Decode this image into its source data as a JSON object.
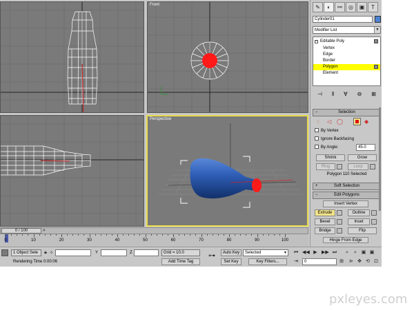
{
  "viewports": {
    "top": "",
    "front": "Front",
    "left": "",
    "perspective": "Perspective"
  },
  "command_panel": {
    "tabs": [
      "create-icon",
      "modify-icon",
      "hierarchy-icon",
      "motion-icon",
      "display-icon",
      "utilities-icon"
    ],
    "object_name": "Cylinder01",
    "object_color": "#4a82d4",
    "modifier_list": "Modifier List",
    "stack": {
      "root": "Editable Poly",
      "items": [
        "Vertex",
        "Edge",
        "Border",
        "Polygon",
        "Element"
      ],
      "selected": "Polygon"
    },
    "selection": {
      "title": "Selection",
      "by_vertex": "By Vertex",
      "ignore_backfacing": "Ignore Backfacing",
      "by_angle": "By Angle:",
      "angle_value": "45.0",
      "shrink": "Shrink",
      "grow": "Grow",
      "ring": "Ring",
      "loop": "Loop",
      "status": "Polygon 110 Selected"
    },
    "soft_selection": {
      "title": "Soft Selection"
    },
    "edit_polygons": {
      "title": "Edit Polygons",
      "insert_vertex": "Insert Vertex",
      "extrude": "Extrude",
      "outline": "Outline",
      "bevel": "Bevel",
      "inset": "Inset",
      "bridge": "Bridge",
      "flip": "Flip",
      "hinge": "Hinge From Edge"
    }
  },
  "timeline": {
    "frame": "0 / 100",
    "ticks": [
      "0",
      "10",
      "20",
      "30",
      "40",
      "50",
      "60",
      "70",
      "80",
      "90",
      "100"
    ]
  },
  "status": {
    "selection": "1 Object Sele",
    "x_label": "X",
    "y_label": "Y",
    "z_label": "Z",
    "grid": "Grid = 10.0",
    "rendering_time": "Rendering Time  0:00:06",
    "add_time_tag": "Add Time Tag",
    "auto_key": "Auto Key",
    "set_key": "Set Key",
    "key_mode": "Selected",
    "key_filters": "Key Filters...",
    "current_frame": "0"
  },
  "watermark": "pxleyes.com"
}
